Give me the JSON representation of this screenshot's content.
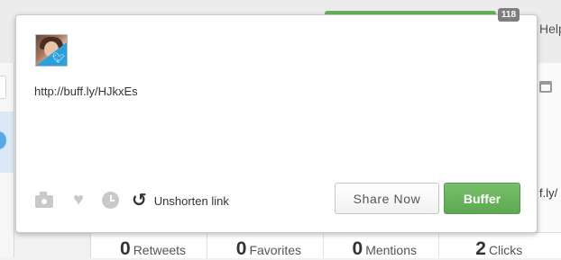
{
  "background": {
    "help_label": "Help",
    "right_link_fragment": "f.ly/",
    "stats": [
      {
        "value": "0",
        "label": "Retweets"
      },
      {
        "value": "0",
        "label": "Favorites"
      },
      {
        "value": "0",
        "label": "Mentions"
      },
      {
        "value": "2",
        "label": "Clicks"
      }
    ]
  },
  "composer": {
    "char_count": "118",
    "text": "http://buff.ly/HJkxEs",
    "avatar_network": "twitter",
    "toolbar": {
      "camera_icon": "camera-icon",
      "heart_icon": "heart-icon",
      "clock_icon": "clock-icon",
      "undo_icon": "undo-icon",
      "unshorten_label": "Unshorten link"
    },
    "share_now_label": "Share Now",
    "buffer_label": "Buffer"
  },
  "colors": {
    "accent_green": "#67b25a",
    "twitter_blue": "#2aa0dc",
    "count_badge": "#7e7e7e"
  }
}
